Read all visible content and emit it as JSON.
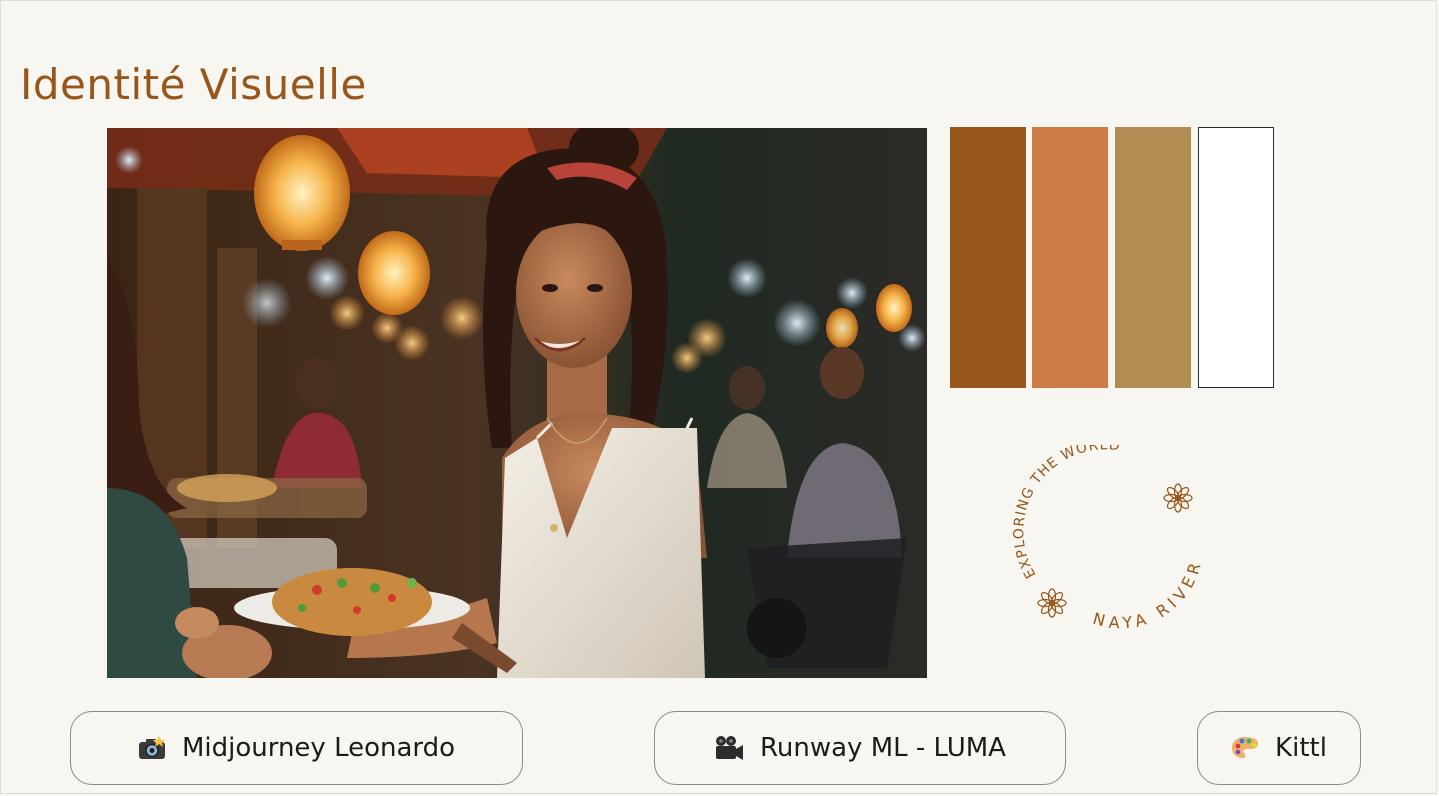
{
  "page": {
    "title": "Identité Visuelle"
  },
  "palette": {
    "swatches": [
      {
        "name": "brown",
        "color": "#99561a"
      },
      {
        "name": "terracotta",
        "color": "#cf7b45"
      },
      {
        "name": "ochre",
        "color": "#b18d54"
      },
      {
        "name": "white",
        "color": "#ffffff"
      }
    ]
  },
  "badge": {
    "top_text": "EXPLORING THE WORLD",
    "bottom_text": "NAYA RIVER",
    "color": "#99561a",
    "icon": "flower-icon"
  },
  "tools": [
    {
      "label": "Midjourney Leonardo",
      "icon": "camera-flash-icon"
    },
    {
      "label": "Runway ML  -  LUMA",
      "icon": "movie-camera-icon"
    },
    {
      "label": "Kittl",
      "icon": "artist-palette-icon"
    }
  ]
}
